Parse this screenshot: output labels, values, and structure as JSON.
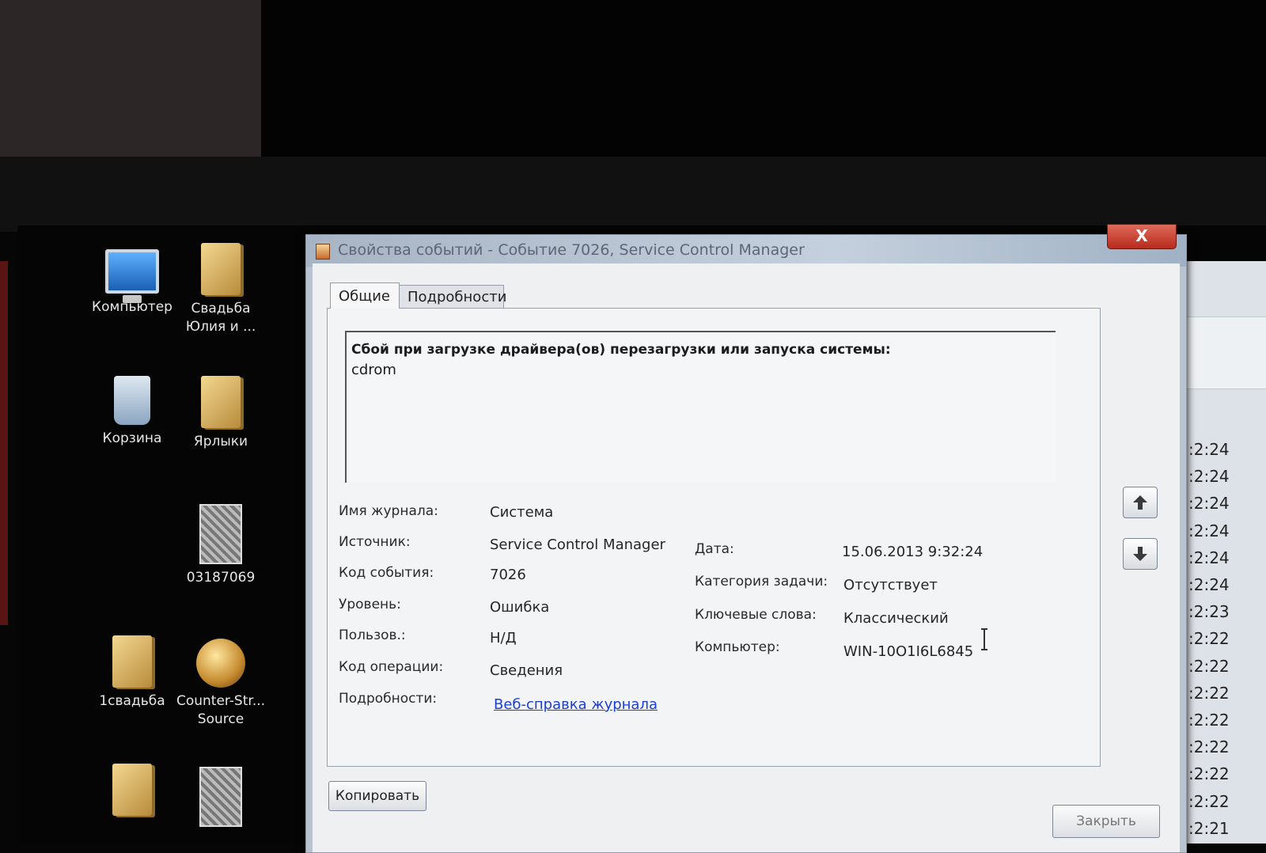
{
  "desktop": {
    "icons": [
      {
        "label": "Компьютер",
        "icon": "computer-icon"
      },
      {
        "label": "Свадьба Юлия и ...",
        "icon": "folder-icon"
      },
      {
        "label": "Корзина",
        "icon": "recycle-bin-icon"
      },
      {
        "label": "Ярлыки",
        "icon": "folder-icon"
      },
      {
        "label": "03187069",
        "icon": "image-file-icon"
      },
      {
        "label": "1свадьба",
        "icon": "folder-icon"
      },
      {
        "label": "Counter-Str... Source",
        "icon": "game-shortcut-icon"
      }
    ]
  },
  "dialog": {
    "title": "Свойства событий - Событие 7026, Service Control Manager",
    "close_label": "X",
    "tabs": [
      {
        "label": "Общие",
        "active": true
      },
      {
        "label": "Подробности",
        "active": false
      }
    ],
    "description": {
      "line1": "Сбой при загрузке драйвера(ов) перезагрузки или запуска системы:",
      "line2": "cdrom"
    },
    "fields_left": [
      {
        "label": "Имя журнала:",
        "value": "Система"
      },
      {
        "label": "Источник:",
        "value": "Service Control Manager"
      },
      {
        "label": "Код события:",
        "value": "7026"
      },
      {
        "label": "Уровень:",
        "value": "Ошибка"
      },
      {
        "label": "Пользов.:",
        "value": "Н/Д"
      },
      {
        "label": "Код операции:",
        "value": "Сведения"
      },
      {
        "label": "Подробности:",
        "value": "Веб-справка журнала"
      }
    ],
    "fields_right": [
      {
        "label": "Дата:",
        "value": "15.06.2013 9:32:24"
      },
      {
        "label": "Категория задачи:",
        "value": "Отсутствует"
      },
      {
        "label": "Ключевые слова:",
        "value": "Классический"
      },
      {
        "label": "Компьютер:",
        "value": "WIN-10O1I6L6845"
      }
    ],
    "buttons": {
      "copy": "Копировать",
      "close": "Закрыть"
    },
    "nav": {
      "up_icon": "arrow-up-icon",
      "down_icon": "arrow-down-icon"
    }
  },
  "background_list": {
    "times": [
      ":2:24",
      ":2:24",
      ":2:24",
      ":2:24",
      ":2:24",
      ":2:24",
      ":2:23",
      ":2:22",
      ":2:22",
      ":2:22",
      ":2:22",
      ":2:22",
      ":2:22",
      ":2:22",
      ":2:21"
    ]
  },
  "colors": {
    "link": "#1a3fd2",
    "close_button": "#c8382a",
    "titlebar": "#b4c2d2"
  }
}
